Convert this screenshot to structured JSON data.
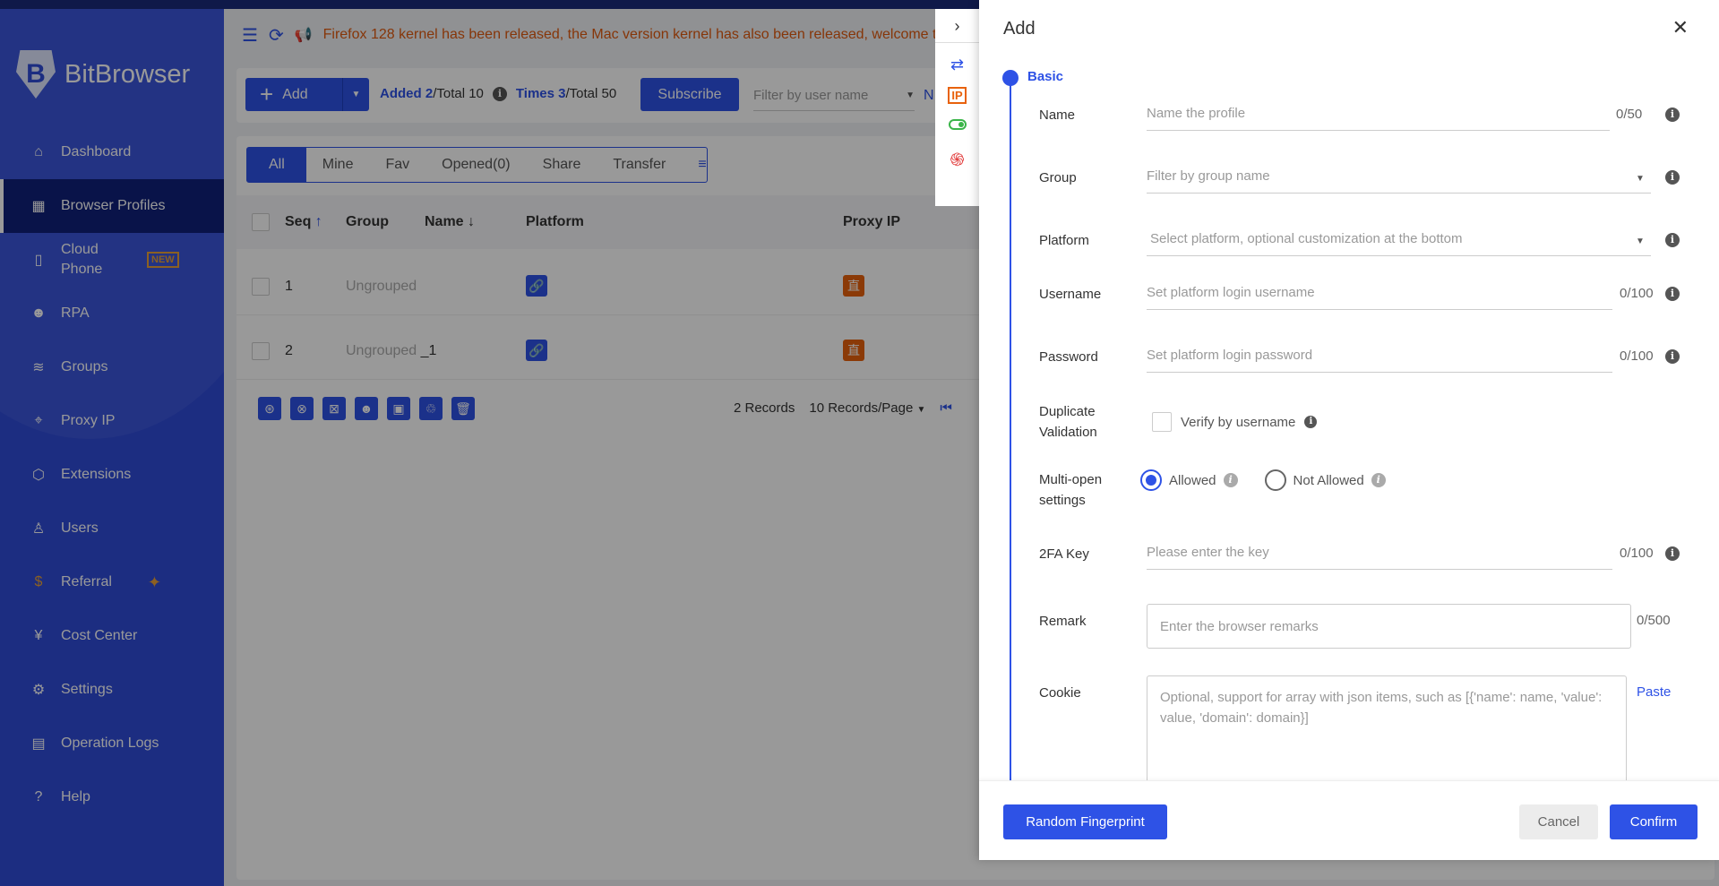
{
  "app": {
    "name": "BitBrowser"
  },
  "sidebar": {
    "items": [
      {
        "label": "Dashboard",
        "icon": "home-icon"
      },
      {
        "label": "Browser Profiles",
        "icon": "grid-icon",
        "active": true
      },
      {
        "label": "Cloud Phone",
        "icon": "phone-icon",
        "badge": "NEW"
      },
      {
        "label": "RPA",
        "icon": "robot-icon"
      },
      {
        "label": "Groups",
        "icon": "layers-icon"
      },
      {
        "label": "Proxy IP",
        "icon": "location-icon"
      },
      {
        "label": "Extensions",
        "icon": "cube-icon"
      },
      {
        "label": "Users",
        "icon": "users-icon"
      },
      {
        "label": "Referral",
        "icon": "dollar-icon"
      },
      {
        "label": "Cost Center",
        "icon": "yen-shield-icon"
      },
      {
        "label": "Settings",
        "icon": "gear-icon"
      },
      {
        "label": "Operation Logs",
        "icon": "log-icon"
      },
      {
        "label": "Help",
        "icon": "help-icon"
      }
    ]
  },
  "notice": {
    "text": "Firefox 128 kernel has been released, the Mac version kernel has also been released, welcome to"
  },
  "toolbar": {
    "add": "Add",
    "added_label": "Added 2",
    "added_total": "/Total 10",
    "times_label": "Times 3",
    "times_total": "/Total 50",
    "subscribe": "Subscribe",
    "filter_placeholder": "Filter by user name",
    "next_filter": "N"
  },
  "tabs": [
    "All",
    "Mine",
    "Fav",
    "Opened(0)",
    "Share",
    "Transfer"
  ],
  "table": {
    "headers": [
      "Seq",
      "Group",
      "Name",
      "Platform",
      "Proxy IP"
    ],
    "rows": [
      {
        "seq": "1",
        "group": "Ungrouped",
        "name": ""
      },
      {
        "seq": "2",
        "group": "Ungrouped",
        "name": "_1"
      }
    ]
  },
  "pagination": {
    "records": "2 Records",
    "per_page": "10 Records/Page"
  },
  "drawer": {
    "title": "Add",
    "section": "Basic",
    "name": {
      "label": "Name",
      "placeholder": "Name the profile",
      "count": "0/50"
    },
    "group": {
      "label": "Group",
      "placeholder": "Filter by group name"
    },
    "platform": {
      "label": "Platform",
      "placeholder": "Select platform, optional customization at the bottom"
    },
    "username": {
      "label": "Username",
      "placeholder": "Set platform login username",
      "count": "0/100"
    },
    "password": {
      "label": "Password",
      "placeholder": "Set platform login password",
      "count": "0/100"
    },
    "duplicate": {
      "label1": "Duplicate",
      "label2": "Validation",
      "option": "Verify by username",
      "checked": false
    },
    "multiopen": {
      "label1": "Multi-open",
      "label2": "settings",
      "allowed": "Allowed",
      "not_allowed": "Not Allowed",
      "selected": "Allowed"
    },
    "twofa": {
      "label": "2FA Key",
      "placeholder": "Please enter the key",
      "count": "0/100"
    },
    "remark": {
      "label": "Remark",
      "placeholder": "Enter the browser remarks",
      "count": "0/500"
    },
    "cookie": {
      "label": "Cookie",
      "placeholder": "Optional, support for array with json items, such as [{'name': name, 'value': value, 'domain': domain}]",
      "paste": "Paste"
    },
    "random": "Random Fingerprint",
    "cancel": "Cancel",
    "confirm": "Confirm"
  },
  "colors": {
    "primary": "#2e52e6",
    "sidebar": "#2f4bd8",
    "notice": "#e05a10",
    "proxy": "#e8620c"
  }
}
